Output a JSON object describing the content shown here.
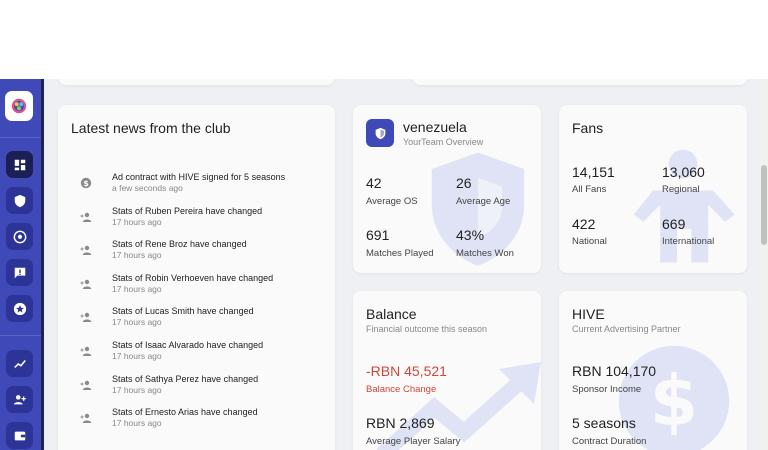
{
  "news": {
    "title": "Latest news from the club",
    "items": [
      {
        "text": "Ad contract with HIVE signed for 5 seasons",
        "time": "a few seconds ago",
        "icon": "dollar-icon"
      },
      {
        "text": "Stats of Ruben Pereira have changed",
        "time": "17 hours ago",
        "icon": "person-add-icon"
      },
      {
        "text": "Stats of Rene Broz have changed",
        "time": "17 hours ago",
        "icon": "person-add-icon"
      },
      {
        "text": "Stats of Robin Verhoeven have changed",
        "time": "17 hours ago",
        "icon": "person-add-icon"
      },
      {
        "text": "Stats of Lucas Smith have changed",
        "time": "17 hours ago",
        "icon": "person-add-icon"
      },
      {
        "text": "Stats of Isaac Alvarado have changed",
        "time": "17 hours ago",
        "icon": "person-add-icon"
      },
      {
        "text": "Stats of Sathya Perez have changed",
        "time": "17 hours ago",
        "icon": "person-add-icon"
      },
      {
        "text": "Stats of Ernesto Arias have changed",
        "time": "17 hours ago",
        "icon": "person-add-icon"
      }
    ]
  },
  "team": {
    "name": "venezuela",
    "subtitle": "YourTeam Overview",
    "stats": [
      {
        "value": "42",
        "label": "Average OS"
      },
      {
        "value": "26",
        "label": "Average Age"
      },
      {
        "value": "691",
        "label": "Matches Played"
      },
      {
        "value": "43%",
        "label": "Matches Won"
      }
    ]
  },
  "fans": {
    "title": "Fans",
    "stats": [
      {
        "value": "14,151",
        "label": "All Fans"
      },
      {
        "value": "13,060",
        "label": "Regional"
      },
      {
        "value": "422",
        "label": "National"
      },
      {
        "value": "669",
        "label": "International"
      }
    ]
  },
  "balance": {
    "title": "Balance",
    "subtitle": "Financial outcome this season",
    "change_value": "-RBN 45,521",
    "change_label": "Balance Change",
    "salary_value": "RBN 2,869",
    "salary_label": "Average Player Salary"
  },
  "sponsor": {
    "title": "HIVE",
    "subtitle": "Current Advertising Partner",
    "income_value": "RBN 104,170",
    "income_label": "Sponsor Income",
    "duration_value": "5 seasons",
    "duration_label": "Contract Duration"
  },
  "sidebar": {
    "items": [
      "dashboard-icon",
      "shield-icon",
      "soccer-ball-icon",
      "alert-icon",
      "star-icon",
      "trending-icon",
      "people-icon",
      "wallet-icon"
    ]
  },
  "colors": {
    "accent": "#3f49b8",
    "negative": "#d0453c",
    "watermark": "#dfe3f5"
  }
}
